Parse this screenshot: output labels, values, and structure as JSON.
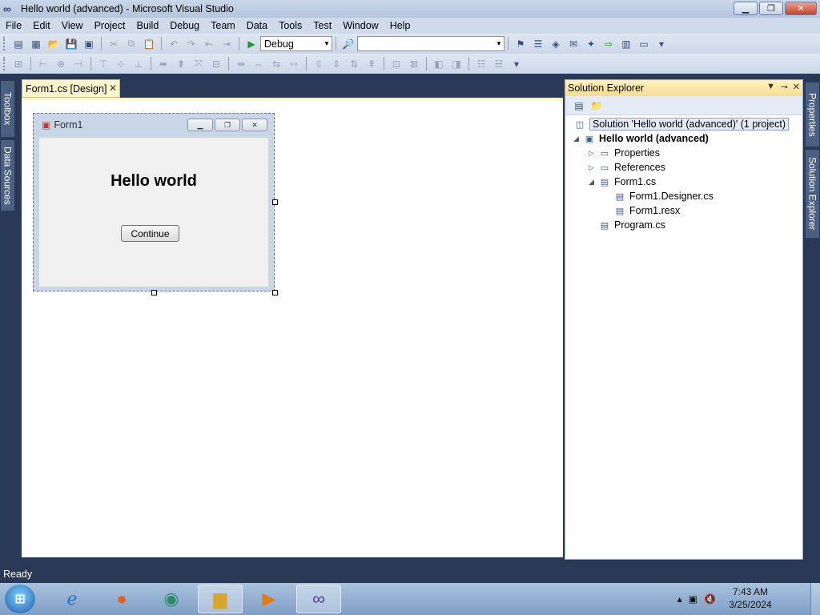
{
  "window": {
    "title": "Hello world (advanced) - Microsoft Visual Studio",
    "minimize_icon": "minimize-icon",
    "maximize_icon": "restore-icon",
    "close_icon": "close-icon"
  },
  "menu": [
    "File",
    "Edit",
    "View",
    "Project",
    "Build",
    "Debug",
    "Team",
    "Data",
    "Tools",
    "Test",
    "Window",
    "Help"
  ],
  "toolbar": {
    "config_value": "Debug",
    "platform_value": ""
  },
  "left_tabs": [
    "Toolbox",
    "Data Sources"
  ],
  "right_tabs": [
    "Properties",
    "Solution Explorer"
  ],
  "document_tab": {
    "label": "Form1.cs [Design]"
  },
  "designer_form": {
    "title": "Form1",
    "label_text": "Hello world",
    "button_text": "Continue"
  },
  "solution_explorer": {
    "title": "Solution Explorer",
    "tree": [
      {
        "label": "Solution 'Hello world (advanced)' (1 project)",
        "icon": "solution-icon"
      },
      {
        "label": "Hello world (advanced)",
        "icon": "csharp-project-icon"
      },
      {
        "label": "Properties",
        "icon": "folder-properties-icon"
      },
      {
        "label": "References",
        "icon": "references-icon"
      },
      {
        "label": "Form1.cs",
        "icon": "form-icon"
      },
      {
        "label": "Form1.Designer.cs",
        "icon": "cs-file-icon"
      },
      {
        "label": "Form1.resx",
        "icon": "resx-file-icon"
      },
      {
        "label": "Program.cs",
        "icon": "cs-file-icon"
      }
    ]
  },
  "status": {
    "text": "Ready"
  },
  "taskbar": {
    "time": "7:43 AM",
    "date": "3/25/2024",
    "apps": [
      "internet-explorer-icon",
      "firefox-icon",
      "edge-icon",
      "file-explorer-icon",
      "media-player-icon",
      "visual-studio-icon"
    ]
  }
}
